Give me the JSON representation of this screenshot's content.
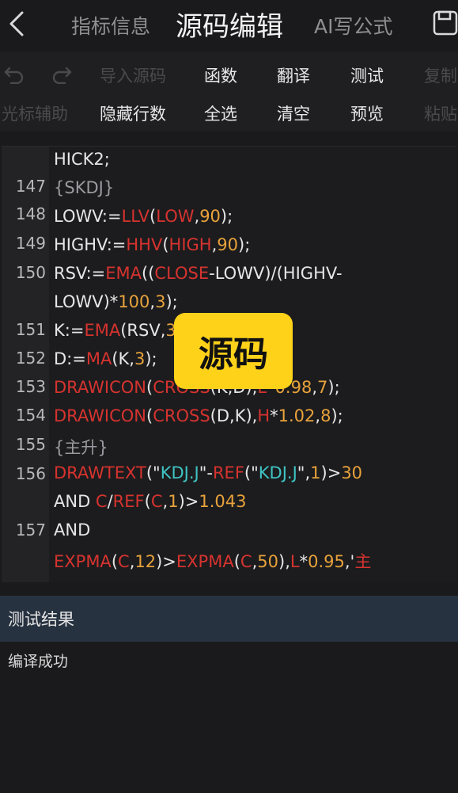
{
  "header": {
    "tabs": [
      "指标信息",
      "源码编辑",
      "AI写公式"
    ],
    "active_tab": 1
  },
  "toolbar": {
    "row1": [
      "导入源码",
      "函数",
      "翻译",
      "测试",
      "复制"
    ],
    "row2": [
      "光标辅助",
      "隐藏行数",
      "全选",
      "清空",
      "预览",
      "粘贴"
    ]
  },
  "editor": {
    "line_numbers": [
      "147",
      "148",
      "149",
      "150",
      "151",
      "152",
      "153",
      "154",
      "155",
      "156",
      "157"
    ],
    "lines": [
      [
        [
          "HICK2;",
          "w"
        ]
      ],
      [
        [
          "{SKDJ}",
          "g"
        ]
      ],
      [
        [
          "LOWV:=",
          "w"
        ],
        [
          "LLV",
          "r"
        ],
        [
          "(",
          "w"
        ],
        [
          "LOW",
          "r"
        ],
        [
          ",",
          "w"
        ],
        [
          "90",
          "o"
        ],
        [
          ");",
          "w"
        ]
      ],
      [
        [
          "HIGHV:=",
          "w"
        ],
        [
          "HHV",
          "r"
        ],
        [
          "(",
          "w"
        ],
        [
          "HIGH",
          "r"
        ],
        [
          ",",
          "w"
        ],
        [
          "90",
          "o"
        ],
        [
          ");",
          "w"
        ]
      ],
      [
        [
          "RSV:=",
          "w"
        ],
        [
          "EMA",
          "r"
        ],
        [
          "((",
          "w"
        ],
        [
          "CLOSE",
          "r"
        ],
        [
          "-LOWV)/(HIGHV-",
          "w"
        ]
      ],
      [
        [
          "LOWV)*",
          "w"
        ],
        [
          "100",
          "o"
        ],
        [
          ",",
          "w"
        ],
        [
          "3",
          "o"
        ],
        [
          ");",
          "w"
        ]
      ],
      [
        [
          "K:=",
          "w"
        ],
        [
          "EMA",
          "r"
        ],
        [
          "(RSV,",
          "w"
        ],
        [
          "3",
          "o"
        ]
      ],
      [
        [
          "D:=",
          "w"
        ],
        [
          "MA",
          "r"
        ],
        [
          "(K,",
          "w"
        ],
        [
          "3",
          "o"
        ],
        [
          ");",
          "w"
        ]
      ],
      [
        [
          "DRAWICON",
          "r"
        ],
        [
          "(",
          "w"
        ],
        [
          "CROSS",
          "r"
        ],
        [
          "(K,D),",
          "w"
        ],
        [
          "L",
          "r"
        ],
        [
          "*",
          "w"
        ],
        [
          "0.98",
          "o"
        ],
        [
          ",",
          "w"
        ],
        [
          "7",
          "o"
        ],
        [
          ");",
          "w"
        ]
      ],
      [
        [
          "DRAWICON",
          "r"
        ],
        [
          "(",
          "w"
        ],
        [
          "CROSS",
          "r"
        ],
        [
          "(D,K),",
          "w"
        ],
        [
          "H",
          "r"
        ],
        [
          "*",
          "w"
        ],
        [
          "1.02",
          "o"
        ],
        [
          ",",
          "w"
        ],
        [
          "8",
          "o"
        ],
        [
          ");",
          "w"
        ]
      ],
      [
        [
          "{主升}",
          "g"
        ]
      ],
      [
        [
          "DRAWTEXT",
          "r"
        ],
        [
          "(\"",
          "w"
        ],
        [
          "KDJ.J",
          "t"
        ],
        [
          "\"-",
          "w"
        ],
        [
          "REF",
          "r"
        ],
        [
          "(\"",
          "w"
        ],
        [
          "KDJ.J",
          "t"
        ],
        [
          "\",",
          "w"
        ],
        [
          "1",
          "o"
        ],
        [
          ")>",
          "w"
        ],
        [
          "30",
          "o"
        ]
      ],
      [
        [
          "AND ",
          "w"
        ],
        [
          "C",
          "r"
        ],
        [
          "/",
          "w"
        ],
        [
          "REF",
          "r"
        ],
        [
          "(",
          "w"
        ],
        [
          "C",
          "r"
        ],
        [
          ",",
          "w"
        ],
        [
          "1",
          "o"
        ],
        [
          ")>",
          "w"
        ],
        [
          "1.043",
          "o"
        ]
      ],
      [
        [
          "AND",
          "w"
        ]
      ],
      [
        [
          "EXPMA",
          "r"
        ],
        [
          "(",
          "w"
        ],
        [
          "C",
          "r"
        ],
        [
          ",",
          "w"
        ],
        [
          "12",
          "o"
        ],
        [
          ")>",
          "w"
        ],
        [
          "EXPMA",
          "r"
        ],
        [
          "(",
          "w"
        ],
        [
          "C",
          "r"
        ],
        [
          ",",
          "w"
        ],
        [
          "50",
          "o"
        ],
        [
          "),",
          "w"
        ],
        [
          "L",
          "r"
        ],
        [
          "*",
          "w"
        ],
        [
          "0.95",
          "o"
        ],
        [
          ",'",
          "w"
        ],
        [
          "主",
          "r"
        ]
      ]
    ]
  },
  "overlay": {
    "label": "源码"
  },
  "result": {
    "title": "测试结果",
    "text": "编译成功"
  },
  "colors": {
    "keyword": "#d6332f",
    "number": "#e8a23b",
    "string": "#3fc3c2",
    "comment": "#9a9aa0",
    "badge": "#ffd21a",
    "result_bar": "#273240"
  }
}
